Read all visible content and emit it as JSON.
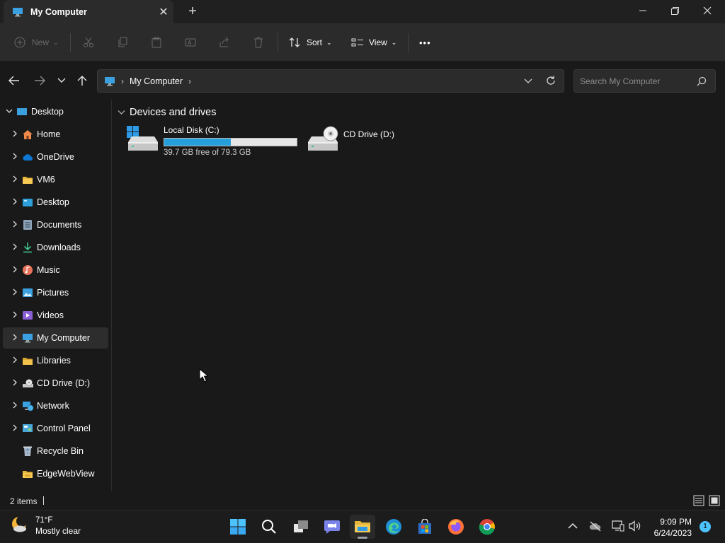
{
  "window": {
    "tab_title": "My Computer",
    "tab_close": "✕",
    "new_tab": "+",
    "minimize": "—",
    "restore": "❐",
    "close": "✕"
  },
  "toolbar": {
    "new_label": "New",
    "sort_label": "Sort",
    "view_label": "View",
    "more_label": "•••"
  },
  "address": {
    "crumb": "My Computer",
    "sep": "›"
  },
  "search": {
    "placeholder": "Search My Computer"
  },
  "sidebar": {
    "items": [
      {
        "label": "Desktop",
        "icon": "desktop-icon",
        "expander": "expanded"
      },
      {
        "label": "Home",
        "icon": "home-icon",
        "expander": "collapsed"
      },
      {
        "label": "OneDrive",
        "icon": "onedrive-icon",
        "expander": "collapsed"
      },
      {
        "label": "VM6",
        "icon": "folder-icon",
        "expander": "collapsed"
      },
      {
        "label": "Desktop",
        "icon": "desktop-folder-icon",
        "expander": "collapsed"
      },
      {
        "label": "Documents",
        "icon": "documents-icon",
        "expander": "collapsed"
      },
      {
        "label": "Downloads",
        "icon": "downloads-icon",
        "expander": "collapsed"
      },
      {
        "label": "Music",
        "icon": "music-icon",
        "expander": "collapsed"
      },
      {
        "label": "Pictures",
        "icon": "pictures-icon",
        "expander": "collapsed"
      },
      {
        "label": "Videos",
        "icon": "videos-icon",
        "expander": "collapsed"
      },
      {
        "label": "My Computer",
        "icon": "computer-icon",
        "expander": "collapsed",
        "selected": true
      },
      {
        "label": "Libraries",
        "icon": "libraries-icon",
        "expander": "collapsed"
      },
      {
        "label": "CD Drive (D:)",
        "icon": "cd-drive-icon",
        "expander": "collapsed"
      },
      {
        "label": "Network",
        "icon": "network-icon",
        "expander": "collapsed"
      },
      {
        "label": "Control Panel",
        "icon": "control-panel-icon",
        "expander": "collapsed"
      },
      {
        "label": "Recycle Bin",
        "icon": "recycle-bin-icon",
        "expander": "none"
      },
      {
        "label": "EdgeWebView",
        "icon": "folder-icon",
        "expander": "none"
      }
    ]
  },
  "content": {
    "group_title": "Devices and drives",
    "drives": [
      {
        "name": "Local Disk (C:)",
        "free_text": "39.7 GB free of 79.3 GB",
        "used_fraction": 0.5
      },
      {
        "name": "CD Drive (D:)"
      }
    ]
  },
  "status": {
    "count": "2 items"
  },
  "taskbar": {
    "temp": "71°F",
    "condition": "Mostly clear",
    "time": "9:09 PM",
    "date": "6/24/2023",
    "notifications": "1",
    "apps": [
      "start-icon",
      "search-icon",
      "task-view-icon",
      "chat-icon",
      "file-explorer-icon",
      "edge-icon",
      "store-icon",
      "firefox-icon",
      "chrome-icon"
    ]
  },
  "colors": {
    "accent": "#26a0da",
    "background": "#191919",
    "chrome": "#2b2b2b"
  }
}
